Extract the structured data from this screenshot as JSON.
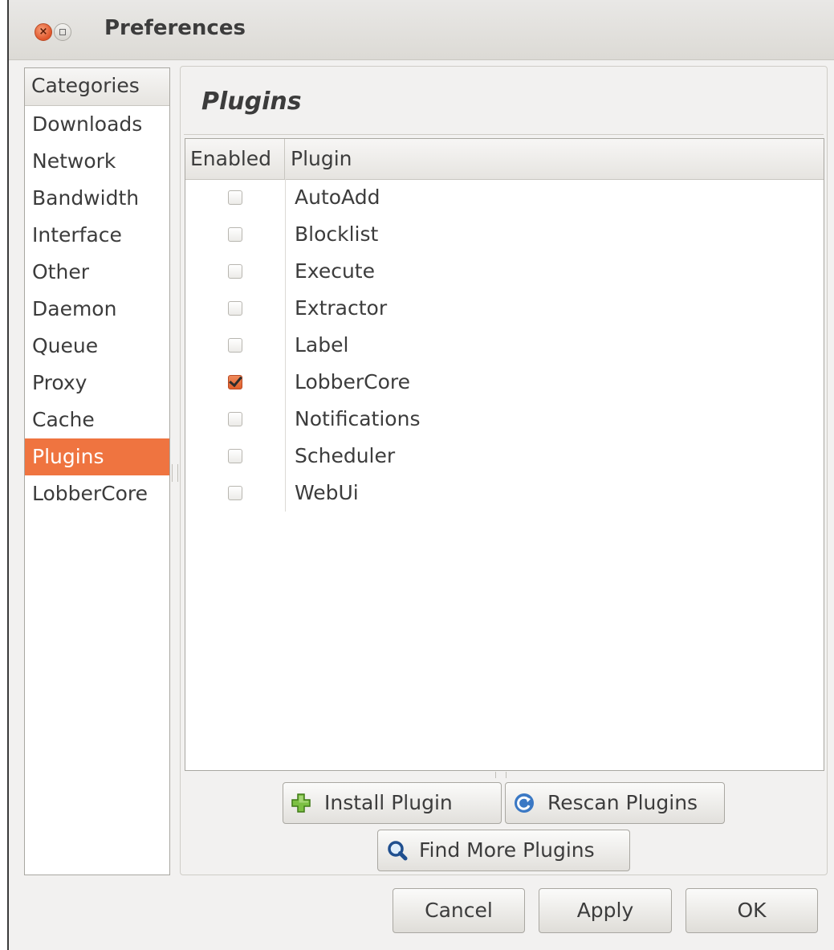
{
  "window": {
    "title": "Preferences"
  },
  "categories": {
    "header": "Categories",
    "items": [
      {
        "label": "Downloads"
      },
      {
        "label": "Network"
      },
      {
        "label": "Bandwidth"
      },
      {
        "label": "Interface"
      },
      {
        "label": "Other"
      },
      {
        "label": "Daemon"
      },
      {
        "label": "Queue"
      },
      {
        "label": "Proxy"
      },
      {
        "label": "Cache"
      },
      {
        "label": "Plugins",
        "selected": true
      },
      {
        "label": "LobberCore"
      }
    ]
  },
  "panel": {
    "title": "Plugins",
    "columns": {
      "enabled": "Enabled",
      "plugin": "Plugin"
    },
    "plugins": [
      {
        "name": "AutoAdd",
        "enabled": false
      },
      {
        "name": "Blocklist",
        "enabled": false
      },
      {
        "name": "Execute",
        "enabled": false
      },
      {
        "name": "Extractor",
        "enabled": false
      },
      {
        "name": "Label",
        "enabled": false
      },
      {
        "name": "LobberCore",
        "enabled": true
      },
      {
        "name": "Notifications",
        "enabled": false
      },
      {
        "name": "Scheduler",
        "enabled": false
      },
      {
        "name": "WebUi",
        "enabled": false
      }
    ],
    "buttons": {
      "install": {
        "label": "Install Plugin",
        "icon": "add-icon"
      },
      "rescan": {
        "label": "Rescan Plugins",
        "icon": "refresh-icon"
      },
      "find": {
        "label": "Find More Plugins",
        "icon": "search-icon"
      }
    }
  },
  "dialog": {
    "cancel": "Cancel",
    "apply": "Apply",
    "ok": "OK"
  },
  "colors": {
    "accent": "#ef7440",
    "window_bg": "#f2f1f0"
  }
}
